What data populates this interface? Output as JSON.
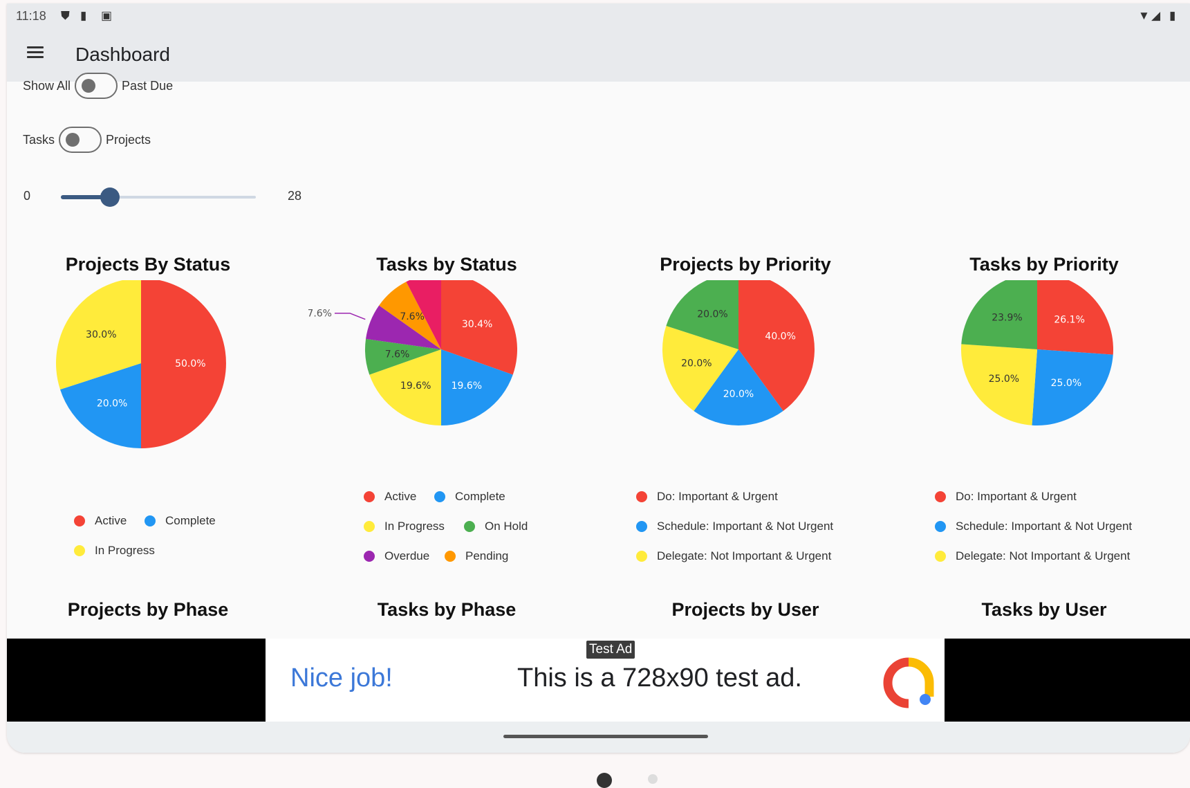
{
  "status_bar": {
    "time": "11:18"
  },
  "app_bar": {
    "title": "Dashboard"
  },
  "toggles": [
    {
      "left_label": "Show All",
      "right_label": "Past Due",
      "on": false
    },
    {
      "left_label": "Tasks",
      "right_label": "Projects",
      "on": false
    }
  ],
  "slider": {
    "min_label": "0",
    "max_label": "28",
    "min": 0,
    "max": 28,
    "value": 7
  },
  "colors": {
    "red": "#f44336",
    "blue": "#2196f3",
    "yellow": "#ffeb3b",
    "green": "#4caf50",
    "purple": "#9c27b0",
    "orange": "#ff9800",
    "pink": "#e91e63"
  },
  "charts": [
    {
      "title": "Projects By Status",
      "legend": [
        {
          "label": "Active",
          "color": "#f44336"
        },
        {
          "label": "Complete",
          "color": "#2196f3"
        },
        {
          "label": "In Progress",
          "color": "#ffeb3b"
        }
      ]
    },
    {
      "title": "Tasks by Status",
      "legend": [
        {
          "label": "Active",
          "color": "#f44336"
        },
        {
          "label": "Complete",
          "color": "#2196f3"
        },
        {
          "label": "In Progress",
          "color": "#ffeb3b"
        },
        {
          "label": "On Hold",
          "color": "#4caf50"
        },
        {
          "label": "Overdue",
          "color": "#9c27b0"
        },
        {
          "label": "Pending",
          "color": "#ff9800"
        }
      ]
    },
    {
      "title": "Projects by Priority",
      "legend": [
        {
          "label": "Do: Important & Urgent",
          "color": "#f44336"
        },
        {
          "label": "Schedule: Important & Not Urgent",
          "color": "#2196f3"
        },
        {
          "label": "Delegate: Not Important & Urgent",
          "color": "#ffeb3b"
        }
      ]
    },
    {
      "title": "Tasks by Priority",
      "legend": [
        {
          "label": "Do: Important & Urgent",
          "color": "#f44336"
        },
        {
          "label": "Schedule: Important & Not Urgent",
          "color": "#2196f3"
        },
        {
          "label": "Delegate: Not Important & Urgent",
          "color": "#ffeb3b"
        }
      ]
    }
  ],
  "second_row_titles": [
    "Projects by Phase",
    "Tasks by Phase",
    "Projects by User",
    "Tasks by User"
  ],
  "chart_data": [
    {
      "type": "pie",
      "title": "Projects By Status",
      "slices": [
        {
          "label": "50.0%",
          "value": 50.0,
          "color": "#f44336"
        },
        {
          "label": "20.0%",
          "value": 20.0,
          "color": "#2196f3"
        },
        {
          "label": "30.0%",
          "value": 30.0,
          "color": "#ffeb3b"
        }
      ]
    },
    {
      "type": "pie",
      "title": "Tasks by Status",
      "slices": [
        {
          "label": "30.4%",
          "value": 30.4,
          "color": "#f44336"
        },
        {
          "label": "19.6%",
          "value": 19.6,
          "color": "#2196f3"
        },
        {
          "label": "19.6%",
          "value": 19.6,
          "color": "#ffeb3b"
        },
        {
          "label": "7.6%",
          "value": 7.6,
          "color": "#4caf50"
        },
        {
          "label": "7.6%",
          "value": 7.6,
          "color": "#9c27b0",
          "outside": true
        },
        {
          "label": "7.6%",
          "value": 7.6,
          "color": "#ff9800"
        },
        {
          "label": "7.6%",
          "value": 7.6,
          "color": "#e91e63",
          "outside": true
        }
      ]
    },
    {
      "type": "pie",
      "title": "Projects by Priority",
      "slices": [
        {
          "label": "40.0%",
          "value": 40.0,
          "color": "#f44336"
        },
        {
          "label": "20.0%",
          "value": 20.0,
          "color": "#2196f3"
        },
        {
          "label": "20.0%",
          "value": 20.0,
          "color": "#ffeb3b"
        },
        {
          "label": "20.0%",
          "value": 20.0,
          "color": "#4caf50"
        }
      ]
    },
    {
      "type": "pie",
      "title": "Tasks by Priority",
      "slices": [
        {
          "label": "26.1%",
          "value": 26.1,
          "color": "#f44336"
        },
        {
          "label": "25.0%",
          "value": 25.0,
          "color": "#2196f3"
        },
        {
          "label": "25.0%",
          "value": 25.0,
          "color": "#ffeb3b"
        },
        {
          "label": "23.9%",
          "value": 23.9,
          "color": "#4caf50"
        }
      ]
    }
  ],
  "ad": {
    "badge": "Test Ad",
    "headline": "Nice job!",
    "body": "This is a 728x90 test ad."
  }
}
